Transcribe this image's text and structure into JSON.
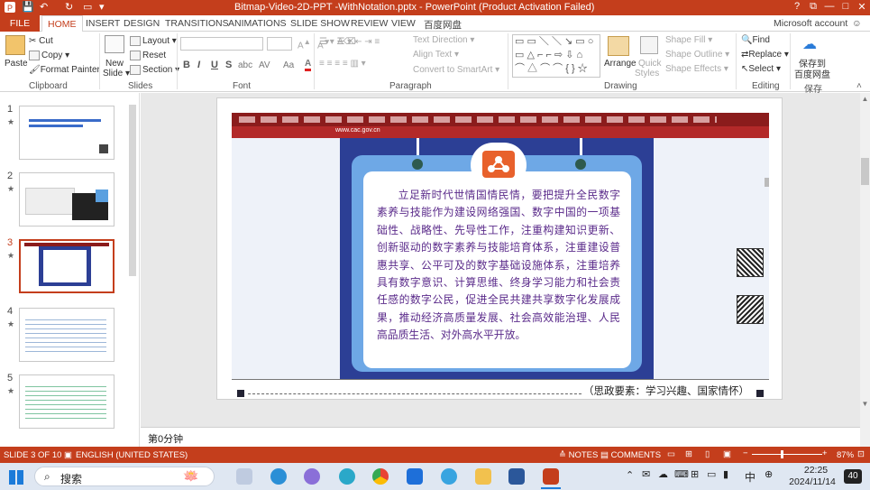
{
  "titlebar": {
    "title": "Bitmap-Video-2D-PPT -WithNotation.pptx -  PowerPoint (Product Activation Failed)",
    "help": "?",
    "restore": "⧉",
    "minimize": "—",
    "maximize": "□",
    "close": "✕"
  },
  "tabs": [
    "HOME",
    "INSERT",
    "DESIGN",
    "TRANSITIONS",
    "ANIMATIONS",
    "SLIDE SHOW",
    "REVIEW",
    "VIEW",
    "百度网盘"
  ],
  "file_tab": "FILE",
  "account": "Microsoft account",
  "ribbon": {
    "clipboard": {
      "label": "Clipboard",
      "paste": "Paste",
      "cut": "Cut",
      "copy": "Copy",
      "format_painter": "Format Painter"
    },
    "slides": {
      "label": "Slides",
      "new_slide": "New",
      "new_slide2": "Slide",
      "layout": "Layout",
      "reset": "Reset",
      "section": "Section"
    },
    "font": {
      "label": "Font",
      "bold": "B",
      "italic": "I",
      "underline": "U",
      "strike": "S",
      "shadow": "abc",
      "spacing": "AV",
      "case": "Aa"
    },
    "paragraph": {
      "label": "Paragraph",
      "text_direction": "Text Direction",
      "align_text": "Align Text",
      "convert": "Convert to SmartArt"
    },
    "drawing": {
      "label": "Drawing",
      "arrange": "Arrange",
      "quick_styles": "Quick",
      "quick_styles2": "Styles",
      "shape_fill": "Shape Fill",
      "shape_outline": "Shape Outline",
      "shape_effects": "Shape Effects"
    },
    "editing": {
      "label": "Editing",
      "find": "Find",
      "replace": "Replace",
      "select": "Select"
    },
    "save": {
      "label": "保存",
      "btn1": "保存到",
      "btn2": "百度网盘"
    }
  },
  "thumbnails": [
    {
      "num": "1",
      "star": "★"
    },
    {
      "num": "2",
      "star": "★"
    },
    {
      "num": "3",
      "star": "★"
    },
    {
      "num": "4",
      "star": "★"
    },
    {
      "num": "5",
      "star": "★"
    }
  ],
  "slide": {
    "text": "立足新时代世情国情民情，要把提升全民数字素养与技能作为建设网络强国、数字中国的一项基础性、战略性、先导性工作，注重构建知识更新、创新驱动的数字素养与技能培育体系，注重建设普惠共享、公平可及的数字基础设施体系，注重培养具有数字意识、计算思维、终身学习能力和社会责任感的数字公民，促进全民共建共享数字化发展成果，推动经济高质量发展、社会高效能治理、人民高品质生活、对外高水平开放。",
    "caption": "（思政要素：学习兴趣、国家情怀）",
    "url": "www.cac.gov.cn"
  },
  "notes": "第0分钟",
  "status": {
    "slide": "SLIDE 3 OF 10",
    "lang": "ENGLISH (UNITED STATES)",
    "notes": "NOTES",
    "comments": "COMMENTS",
    "zoom": "87%"
  },
  "taskbar": {
    "search": "搜索",
    "time": "22:25",
    "date": "2024/11/14",
    "ime": "中",
    "notif": "40"
  },
  "colors": {
    "accent": "#c43e1c",
    "poster": "#2c3f95",
    "text": "#5a2a8a"
  }
}
